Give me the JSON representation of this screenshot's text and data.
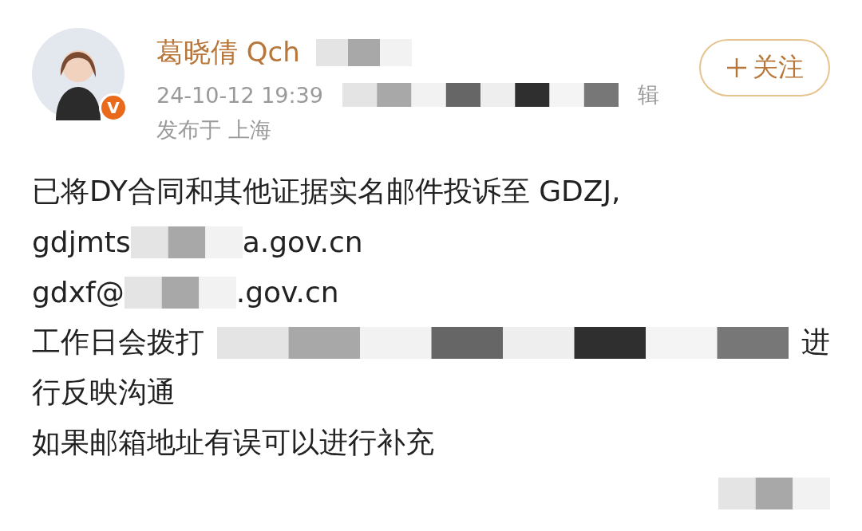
{
  "post": {
    "author": {
      "name": "葛晓倩 Qch",
      "verified_badge": "V",
      "name_tail": [
        {
          "kind": "mosaic"
        }
      ]
    },
    "meta": [
      {
        "kind": "text",
        "text": "24-10-12 19:39"
      },
      {
        "kind": "mosaic_wide"
      },
      {
        "kind": "text",
        "text": "辑"
      }
    ],
    "location": "发布于 上海",
    "follow_button": "关注",
    "body": [
      [
        {
          "kind": "text",
          "text": "已将DY合同和其他证据实名邮件投诉至 GDZJ,"
        }
      ],
      [
        {
          "kind": "text",
          "text": "gdjmts"
        },
        {
          "kind": "mosaic"
        },
        {
          "kind": "text",
          "text": "a.gov.cn"
        }
      ],
      [
        {
          "kind": "text",
          "text": "gdxf@"
        },
        {
          "kind": "mosaic"
        },
        {
          "kind": "text",
          "text": ".gov.cn"
        }
      ],
      [
        {
          "kind": "text",
          "text": "工作日会拨打"
        },
        {
          "kind": "mosaic_wide"
        },
        {
          "kind": "text",
          "text": "进"
        }
      ],
      [
        {
          "kind": "text",
          "text": "行反映沟通"
        }
      ],
      [
        {
          "kind": "text",
          "text": "如果邮箱地址有误可以进行补充"
        }
      ],
      [
        {
          "kind": "spacer"
        },
        {
          "kind": "mosaic"
        }
      ]
    ]
  }
}
